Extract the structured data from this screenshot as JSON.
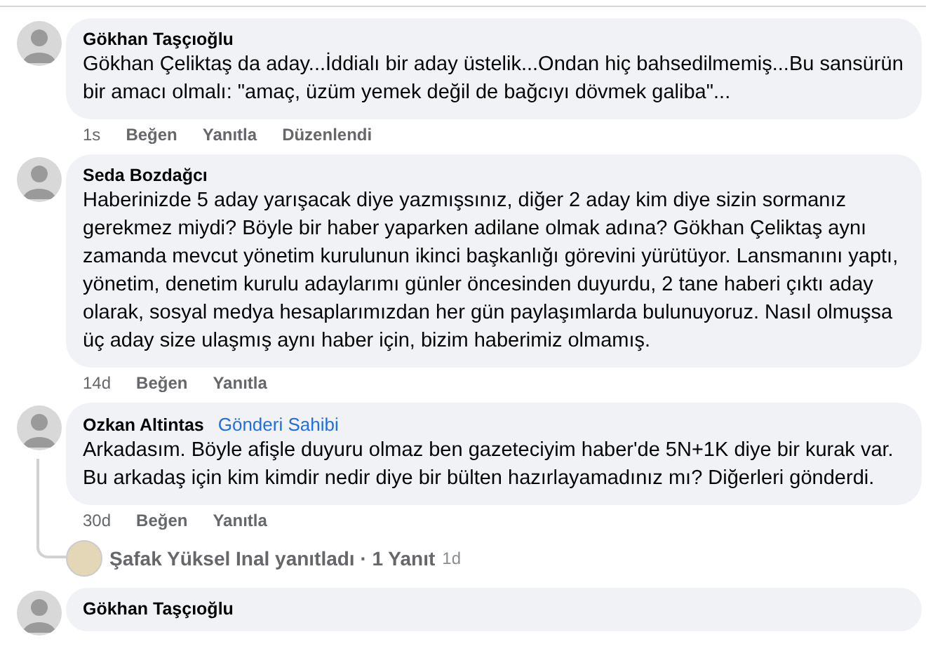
{
  "comments": [
    {
      "author": "Gökhan Taşçıoğlu",
      "body": "Gökhan Çeliktaş da aday...İddialı bir aday üstelik...Ondan hiç bahsedilmemiş...Bu sansürün bir amacı olmalı: \"amaç, üzüm yemek değil de bağcıyı dövmek galiba\"...",
      "time": "1s",
      "actions": [
        "Beğen",
        "Yanıtla",
        "Düzenlendi"
      ]
    },
    {
      "author": "Seda Bozdağcı",
      "body": "Haberinizde 5 aday yarışacak diye yazmışsınız, diğer 2 aday kim diye sizin sormanız gerekmez miydi? Böyle bir haber yaparken adilane olmak adına? Gökhan Çeliktaş aynı zamanda mevcut yönetim kurulunun ikinci başkanlığı görevini yürütüyor. Lansmanını yaptı, yönetim, denetim kurulu adaylarımı günler öncesinden duyurdu, 2 tane haberi çıktı aday olarak, sosyal medya hesaplarımızdan her gün paylaşımlarda bulunuyoruz. Nasıl olmuşsa üç aday size ulaşmış aynı haber için, bizim haberimiz olmamış.",
      "time": "14d",
      "actions": [
        "Beğen",
        "Yanıtla"
      ]
    },
    {
      "author": "Ozkan Altintas",
      "badge": "Gönderi Sahibi",
      "body": "Arkadasım. Böyle afişle duyuru olmaz ben gazeteciyim haber'de 5N+1K diye bir kurak var. Bu arkadaş için kim kimdir nedir diye bir bülten hazırlayamadınız mı? Diğerleri gönderdi.",
      "time": "30d",
      "actions": [
        "Beğen",
        "Yanıtla"
      ],
      "replies": {
        "text": "Şafak Yüksel Inal yanıtladı · 1 Yanıt",
        "time": "1d"
      }
    },
    {
      "author": "Gökhan Taşçıoğlu"
    }
  ]
}
